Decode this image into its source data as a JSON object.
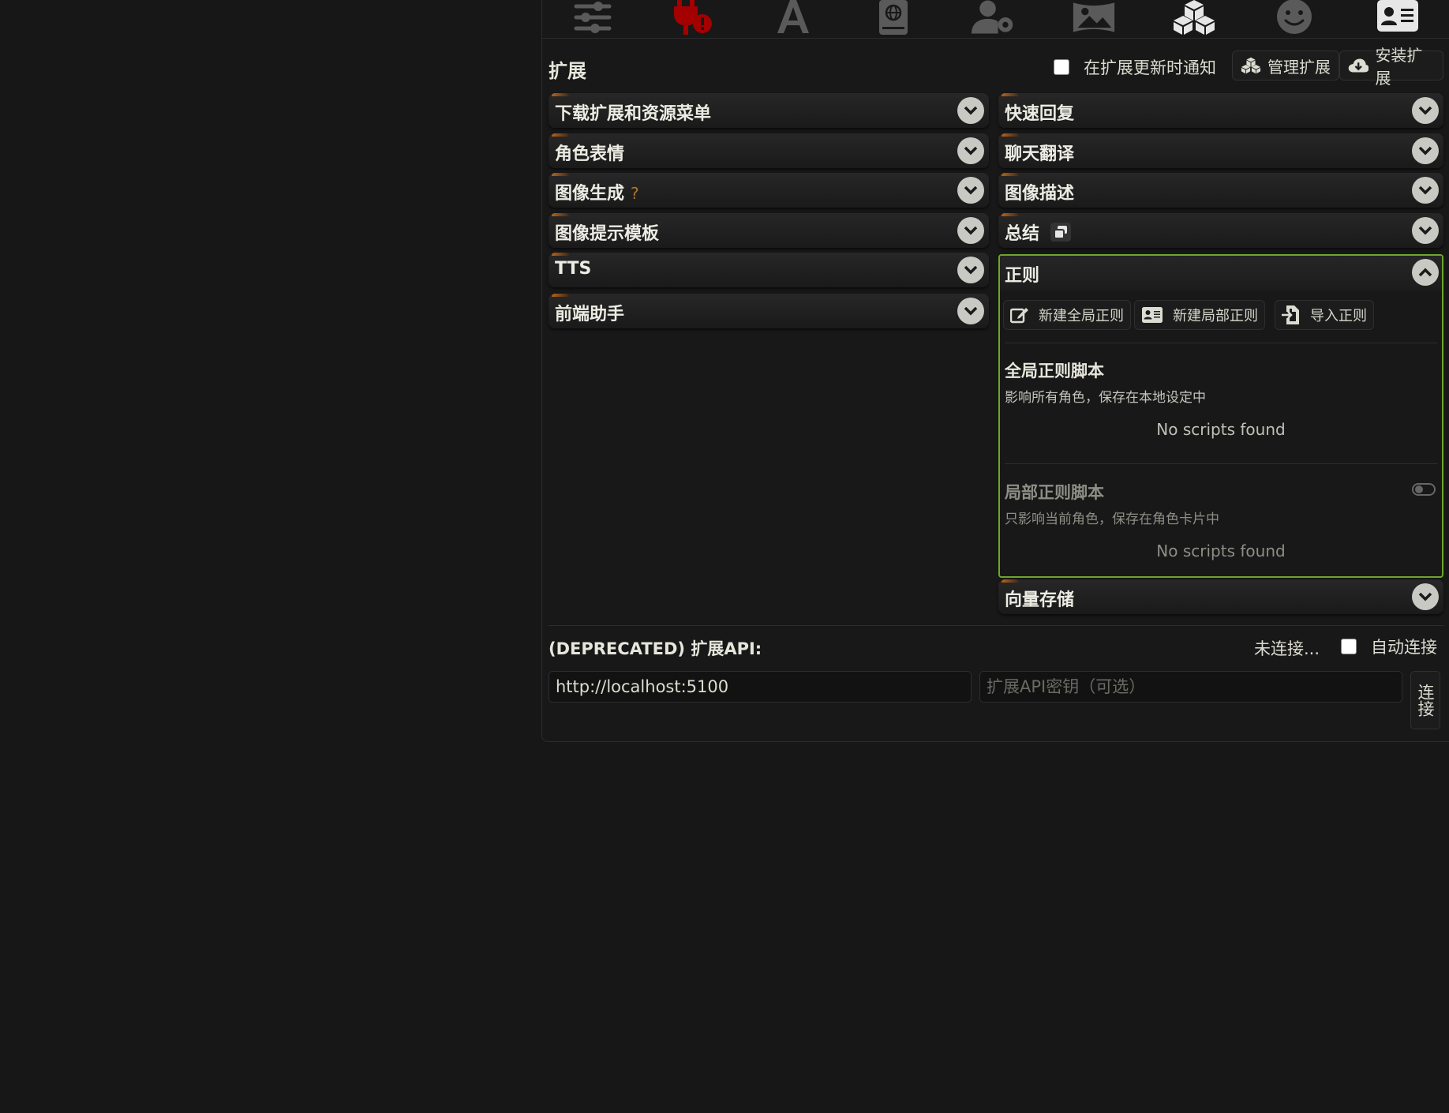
{
  "topbar": {
    "icons": [
      "sliders-icon",
      "plug-alert-icon",
      "font-icon",
      "book-globe-icon",
      "user-gear-icon",
      "image-icon",
      "cubes-icon",
      "smile-icon",
      "id-card-icon"
    ]
  },
  "header": {
    "title": "扩展",
    "notify_label": "在扩展更新时通知",
    "manage_label": "管理扩展",
    "install_label": "安装扩展"
  },
  "left_drawers": [
    {
      "label": "下载扩展和资源菜单"
    },
    {
      "label": "角色表情"
    },
    {
      "label": "图像生成",
      "help": "?"
    },
    {
      "label": "图像提示模板"
    },
    {
      "label": "TTS"
    },
    {
      "label": "前端助手"
    }
  ],
  "right_drawers": [
    {
      "label": "快速回复"
    },
    {
      "label": "聊天翻译"
    },
    {
      "label": "图像描述"
    },
    {
      "label": "总结"
    }
  ],
  "regex": {
    "label": "正则",
    "new_global": "新建全局正则",
    "new_scoped": "新建局部正则",
    "import": "导入正则",
    "global_title": "全局正则脚本",
    "global_sub": "影响所有角色，保存在本地设定中",
    "global_empty": "No scripts found",
    "scoped_title": "局部正则脚本",
    "scoped_sub": "只影响当前角色，保存在角色卡片中",
    "scoped_empty": "No scripts found"
  },
  "vector_drawer": {
    "label": "向量存储"
  },
  "api": {
    "title": "(DEPRECATED) 扩展API:",
    "status": "未连接...",
    "auto_label": "自动连接",
    "url_value": "http://localhost:5100",
    "key_placeholder": "扩展API密钥（可选）",
    "connect_label": "连接"
  },
  "colors": {
    "accent_green": "#6fa52a",
    "alert_red": "#b00000",
    "help_orange": "#b5732a"
  }
}
